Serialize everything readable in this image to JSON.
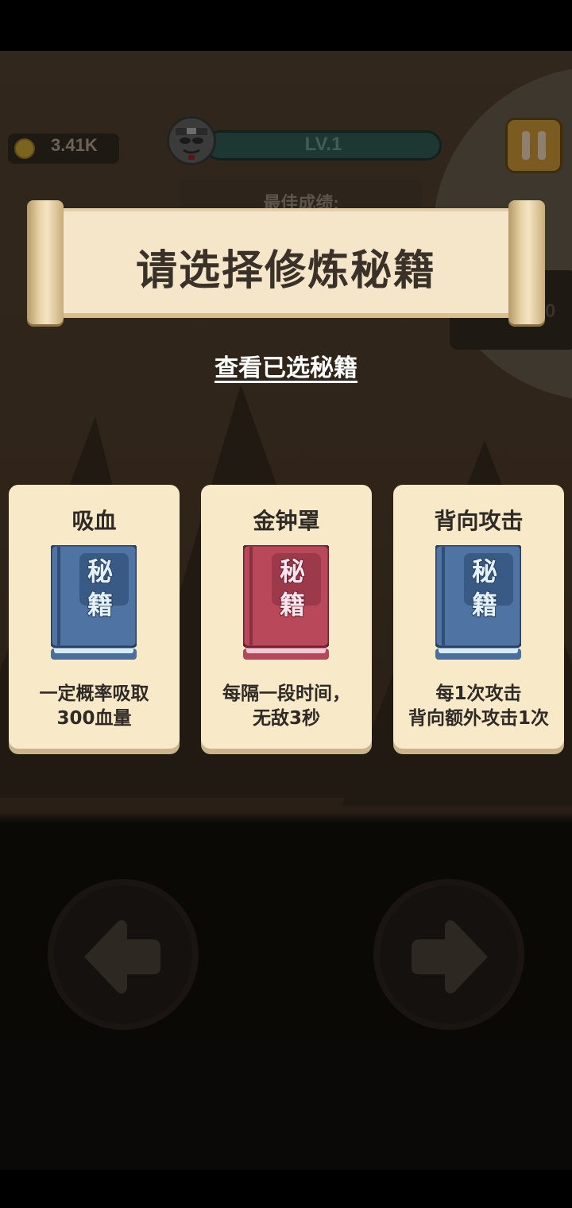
{
  "hud": {
    "coins": "3.41K",
    "level": "LV.1",
    "best_score_label": "最佳成绩:",
    "side_value": "0"
  },
  "dialog": {
    "title": "请选择修炼秘籍",
    "view_selected_link": "查看已选秘籍"
  },
  "cards": [
    {
      "name": "吸血",
      "book_line1": "秘",
      "book_line2": "籍",
      "book_color": "blue",
      "desc": [
        "一定概率吸取",
        "300血量"
      ]
    },
    {
      "name": "金钟罩",
      "book_line1": "秘",
      "book_line2": "籍",
      "book_color": "red",
      "desc": [
        "每隔一段时间，",
        "无敌3秒"
      ]
    },
    {
      "name": "背向攻击",
      "book_line1": "秘",
      "book_line2": "籍",
      "book_color": "blue",
      "desc": [
        "每1次攻击",
        "背向额外攻击1次"
      ]
    }
  ],
  "controls": {
    "left": "left-arrow-icon",
    "right": "right-arrow-icon"
  },
  "colors": {
    "card_bg": "#f8e9c9",
    "blue_book": "#4f73a3",
    "red_book": "#b9485a",
    "text_dark": "#2f2a26"
  }
}
